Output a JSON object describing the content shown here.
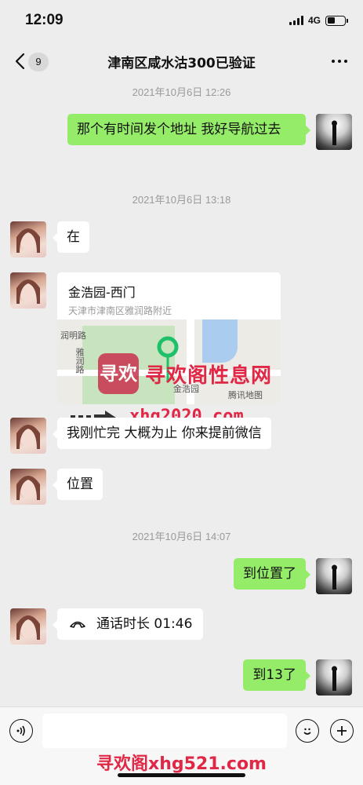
{
  "status_bar": {
    "time": "12:09",
    "network": "4G"
  },
  "nav": {
    "unread_count": "9",
    "title": "津南区咸水沽300已验证"
  },
  "messages": {
    "ts1": "2021年10月6日 12:26",
    "m1": "那个有时间发个地址 我好导航过去",
    "ts2": "2021年10月6日 13:18",
    "m2": "在",
    "location": {
      "title": "金浩园-西门",
      "address": "天津市津南区雅润路附近",
      "map_labels": {
        "road1": "雅润路",
        "road2": "润明路",
        "place": "金浩园",
        "provider": "腾讯地图"
      }
    },
    "m3": "我刚忙完 大概为止 你来提前微信",
    "m4": "位置",
    "ts3": "2021年10月6日 14:07",
    "m5": "到位置了",
    "call": "通话时长 01:46",
    "m6": "到13了"
  },
  "watermark": {
    "logo": "寻欢",
    "title": "寻欢阁性息网",
    "url": "xhg2020.com",
    "bottom": "寻欢阁xhg521.com"
  },
  "colors": {
    "green_bubble": "#95ec69",
    "watermark_red": "#e02846",
    "background": "#ededed"
  }
}
